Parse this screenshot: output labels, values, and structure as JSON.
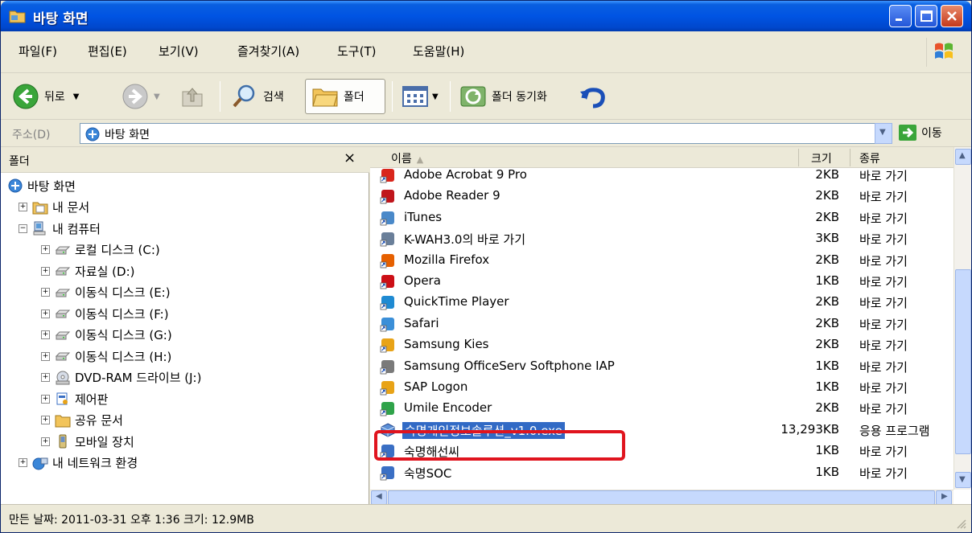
{
  "window": {
    "title": "바탕 화면"
  },
  "menu": [
    "파일(F)",
    "편집(E)",
    "보기(V)",
    "즐겨찾기(A)",
    "도구(T)",
    "도움말(H)"
  ],
  "toolbar": {
    "back_label": "뒤로",
    "search_label": "검색",
    "folders_label": "폴더",
    "sync_label": "폴더 동기화"
  },
  "address": {
    "label": "주소(D)",
    "value": "바탕 화면",
    "go_label": "이동"
  },
  "folder_pane": {
    "title": "폴더",
    "close": "×",
    "tree": [
      {
        "label": "바탕 화면",
        "level": 0,
        "expander": "",
        "icon": "desktop-icon"
      },
      {
        "label": "내 문서",
        "level": 1,
        "expander": "+",
        "icon": "documents-folder-icon"
      },
      {
        "label": "내 컴퓨터",
        "level": 1,
        "expander": "−",
        "icon": "my-computer-icon"
      },
      {
        "label": "로컬 디스크 (C:)",
        "level": 2,
        "expander": "+",
        "icon": "drive-icon"
      },
      {
        "label": "자료실 (D:)",
        "level": 2,
        "expander": "+",
        "icon": "drive-icon"
      },
      {
        "label": "이동식 디스크 (E:)",
        "level": 2,
        "expander": "+",
        "icon": "drive-icon"
      },
      {
        "label": "이동식 디스크 (F:)",
        "level": 2,
        "expander": "+",
        "icon": "drive-icon"
      },
      {
        "label": "이동식 디스크 (G:)",
        "level": 2,
        "expander": "+",
        "icon": "drive-icon"
      },
      {
        "label": "이동식 디스크 (H:)",
        "level": 2,
        "expander": "+",
        "icon": "drive-icon"
      },
      {
        "label": "DVD-RAM 드라이브 (J:)",
        "level": 2,
        "expander": "+",
        "icon": "dvd-drive-icon"
      },
      {
        "label": "제어판",
        "level": 2,
        "expander": "+",
        "icon": "control-panel-icon"
      },
      {
        "label": "공유 문서",
        "level": 2,
        "expander": "+",
        "icon": "folder-icon"
      },
      {
        "label": "모바일 장치",
        "level": 2,
        "expander": "+",
        "icon": "mobile-device-icon"
      },
      {
        "label": "내 네트워크 환경",
        "level": 1,
        "expander": "+",
        "icon": "network-icon"
      }
    ]
  },
  "columns": {
    "name": "이름",
    "size": "크기",
    "type": "종류"
  },
  "files": [
    {
      "name": "Adobe Acrobat 9 Pro",
      "size": "2KB",
      "type": "바로 가기",
      "icon": "acrobat-icon",
      "color": "#d9261c"
    },
    {
      "name": "Adobe Reader 9",
      "size": "2KB",
      "type": "바로 가기",
      "icon": "adobe-reader-icon",
      "color": "#c0161c"
    },
    {
      "name": "iTunes",
      "size": "2KB",
      "type": "바로 가기",
      "icon": "itunes-icon",
      "color": "#4a89c9"
    },
    {
      "name": "K-WAH3.0의 바로 가기",
      "size": "3KB",
      "type": "바로 가기",
      "icon": "kwah-icon",
      "color": "#6a7f99"
    },
    {
      "name": "Mozilla Firefox",
      "size": "2KB",
      "type": "바로 가기",
      "icon": "firefox-icon",
      "color": "#e66000"
    },
    {
      "name": "Opera",
      "size": "1KB",
      "type": "바로 가기",
      "icon": "opera-icon",
      "color": "#cc0f16"
    },
    {
      "name": "QuickTime Player",
      "size": "2KB",
      "type": "바로 가기",
      "icon": "quicktime-icon",
      "color": "#1f8ad2"
    },
    {
      "name": "Safari",
      "size": "2KB",
      "type": "바로 가기",
      "icon": "safari-icon",
      "color": "#3b8fd8"
    },
    {
      "name": "Samsung Kies",
      "size": "2KB",
      "type": "바로 가기",
      "icon": "samsung-kies-icon",
      "color": "#e8a317"
    },
    {
      "name": "Samsung OfficeServ Softphone IAP",
      "size": "1KB",
      "type": "바로 가기",
      "icon": "softphone-icon",
      "color": "#7a7a7a"
    },
    {
      "name": "SAP Logon",
      "size": "1KB",
      "type": "바로 가기",
      "icon": "sap-logon-icon",
      "color": "#e8a317"
    },
    {
      "name": "Umile Encoder",
      "size": "2KB",
      "type": "바로 가기",
      "icon": "umile-encoder-icon",
      "color": "#2fa34a"
    },
    {
      "name": "숙명개인정보솔루션_v1.0.exe",
      "size": "13,293KB",
      "type": "응용 프로그램",
      "icon": "exe-cube-icon",
      "color": "#3a6fc4",
      "selected": true
    },
    {
      "name": "숙명해선씨",
      "size": "1KB",
      "type": "바로 가기",
      "icon": "shortcut-icon",
      "color": "#3a6fc4"
    },
    {
      "name": "숙명SOC",
      "size": "1KB",
      "type": "바로 가기",
      "icon": "shortcut-icon",
      "color": "#3a6fc4"
    }
  ],
  "status": {
    "text": "만든 날짜: 2011-03-31 오후 1:36 크기: 12.9MB"
  },
  "colors": {
    "title_blue": "#0054e3",
    "selection": "#316ac5",
    "highlight_red": "#e0141e",
    "chrome": "#ece9d8"
  }
}
